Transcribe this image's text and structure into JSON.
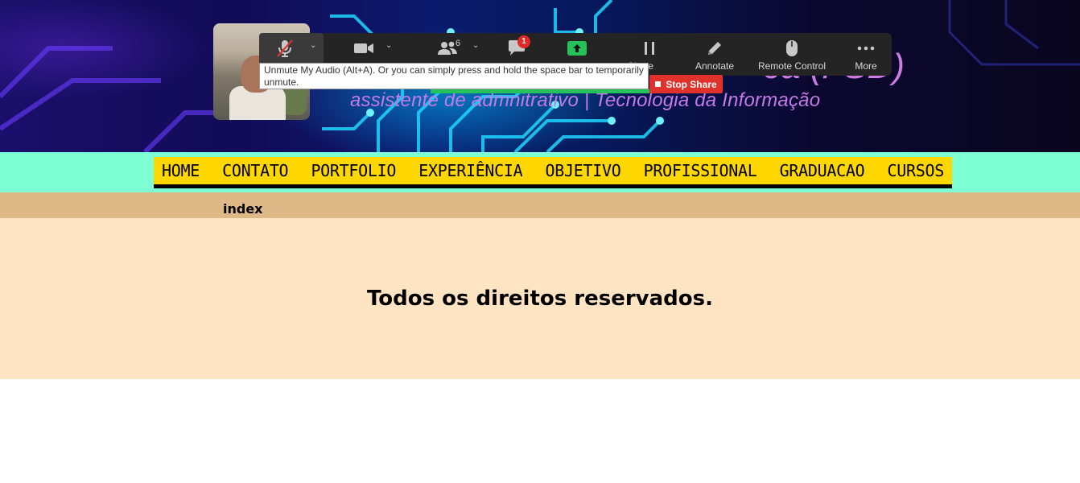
{
  "banner": {
    "title_partial": "ca (FSD)",
    "subtitle": "assistente de admnitrativo | Tecnologia da Informação"
  },
  "zoom": {
    "participants_count": "6",
    "chat_badge": "1",
    "labels": {
      "share": "Share",
      "annotate": "Annotate",
      "remote_control": "Remote Control",
      "more": "More"
    },
    "tooltip": "Unmute My Audio (Alt+A). Or you can simply press and hold the space bar to temporarily unmute.",
    "stop_share": "Stop Share"
  },
  "nav": {
    "items": [
      "HOME",
      "CONTATO",
      "PORTFOLIO",
      "EXPERIÊNCIA",
      "OBJETIVO",
      "PROFISSIONAL",
      "GRADUACAO",
      "CURSOS"
    ]
  },
  "breadcrumb": "index",
  "footer": {
    "text": "Todos os direitos reservados."
  },
  "colors": {
    "nav_band": "#7fffd4",
    "nav_bg": "#ffd700",
    "crumb_bar": "#deb887",
    "footer_bg": "#ffe4c4",
    "stop_share": "#e0312b",
    "share_green": "#25c25a"
  }
}
